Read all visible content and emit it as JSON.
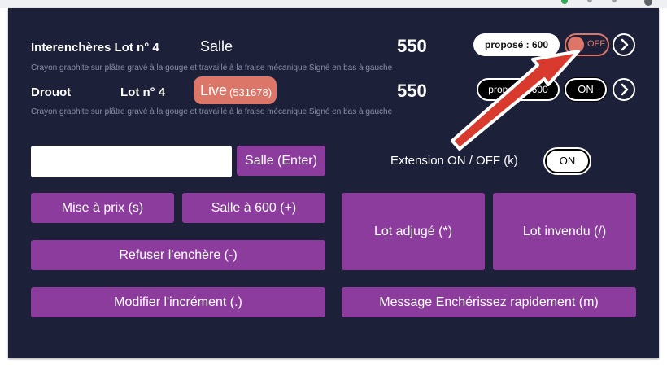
{
  "row1": {
    "title": "Interenchères Lot n° 4",
    "room": "Salle",
    "price": "550",
    "proposal": "proposé : 600",
    "toggle": "OFF",
    "description": "Crayon graphite sur plâtre gravé à la gouge et travaillé à la fraise mécanique Signé en bas à gauche"
  },
  "row2": {
    "site": "Drouot",
    "lot": "Lot n° 4",
    "live_label": "Live",
    "live_id": "(531678)",
    "price": "550",
    "proposal": "proposé : 600",
    "toggle": "ON",
    "description": "Crayon graphite sur plâtre gravé à la gouge et travaillé à la fraise mécanique Signé en bas à gauche"
  },
  "input": {
    "value": "",
    "placeholder": ""
  },
  "salle_button": "Salle (Enter)",
  "extension": {
    "label": "Extension ON / OFF (k)",
    "toggle": "ON"
  },
  "buttons": {
    "mise_a_prix": "Mise à prix (s)",
    "salle_600": "Salle à 600 (+)",
    "refuser": "Refuser l'enchère (-)",
    "modifier": "Modifier l'incrément (.)",
    "lot_adjuge": "Lot adjugé (*)",
    "lot_invendu": "Lot invendu (/)",
    "message": "Message Enchérissez rapidement (m)"
  },
  "colors": {
    "panel_bg": "#1c2039",
    "button_purple": "#8c3c9c",
    "live_badge": "#dc7668",
    "arrow_red": "#d93a2e"
  }
}
